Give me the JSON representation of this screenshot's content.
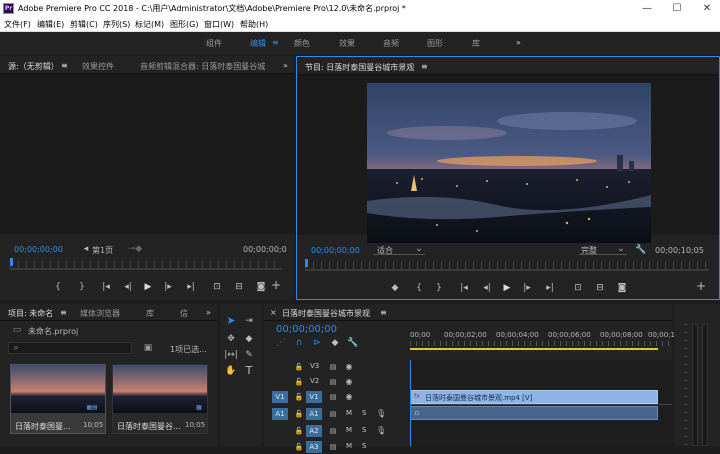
{
  "titlebar": {
    "icon": "Pr",
    "title": "Adobe Premiere Pro CC 2018 - C:\\用户\\Administrator\\文档\\Adobe\\Premiere Pro\\12.0\\未命名.prproj *",
    "minimize": "—",
    "maximize": "☐",
    "close": "✕"
  },
  "menu": [
    "文件(F)",
    "编辑(E)",
    "剪辑(C)",
    "序列(S)",
    "标记(M)",
    "图形(G)",
    "窗口(W)",
    "帮助(H)"
  ],
  "workspaces": {
    "items": [
      "组件",
      "编辑",
      "颜色",
      "效果",
      "音频",
      "图形",
      "库"
    ],
    "active": "编辑",
    "menu_glyph": "≡",
    "more": "»"
  },
  "source_panel": {
    "tabs": [
      "源:（无剪辑）",
      "效果控件",
      "音频剪辑混合器: 日落时泰国曼谷城"
    ],
    "menu_glyph": "≡",
    "more": "»",
    "timecode_left": "00;00;00;00",
    "page_label": "第1页",
    "timecode_right": "00;00;00;0"
  },
  "program_panel": {
    "title": "节目: 日落时泰国曼谷城市景观",
    "menu_glyph": "≡",
    "timecode_left": "00;00;00;00",
    "fit": "适合",
    "quality": "完整",
    "timecode_right": "00;00;10;05"
  },
  "project_panel": {
    "tabs": [
      "项目: 未命名",
      "媒体浏览器",
      "库",
      "信"
    ],
    "menu_glyph": "≡",
    "more": "»",
    "file": "未命名.prproj",
    "search_placeholder": "",
    "items_selected": "1项已选...",
    "clips": [
      {
        "name": "日落时泰国曼...",
        "duration": "10;05"
      },
      {
        "name": "日落时泰国曼谷...",
        "duration": "10;05"
      }
    ]
  },
  "timeline": {
    "close": "×",
    "title": "日落时泰国曼谷城市景观",
    "menu_glyph": "≡",
    "timecode": "00;00;00;00",
    "ruler": [
      "00;00",
      "00;00;02;00",
      "00;00;04;00",
      "00;00;06;00",
      "00;00;08;00",
      "00;00;10"
    ],
    "tracks": [
      {
        "src": "",
        "name": "V3",
        "type": "video"
      },
      {
        "src": "",
        "name": "V2",
        "type": "video"
      },
      {
        "src": "V1",
        "name": "V1",
        "type": "video"
      },
      {
        "src": "A1",
        "name": "A1",
        "type": "audio"
      },
      {
        "src": "",
        "name": "A2",
        "type": "audio"
      },
      {
        "src": "",
        "name": "A3",
        "type": "audio"
      }
    ],
    "clip_label": "日落时泰国曼谷城市景观.mp4 [V]",
    "mute": "M",
    "solo": "S"
  },
  "colors": {
    "accent": "#2d8ceb",
    "clip_video": "#8cb4e4",
    "clip_audio": "#47658c",
    "panel": "#232323",
    "background": "#1d1d1d"
  }
}
